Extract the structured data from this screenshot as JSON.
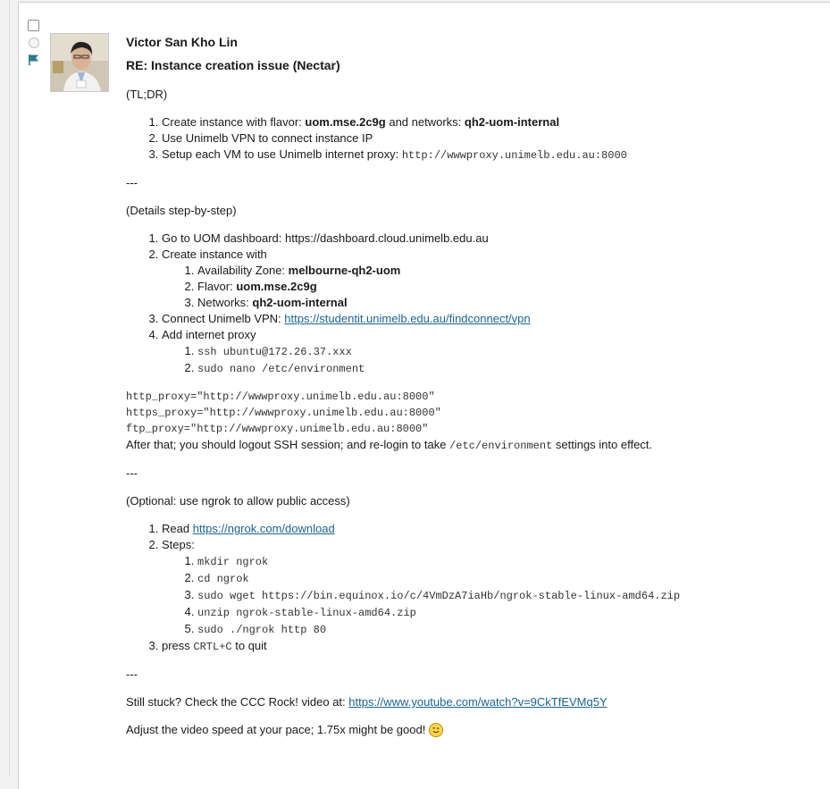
{
  "post": {
    "author": "Victor San Kho Lin",
    "subject": "RE: Instance creation issue (Nectar)",
    "tldr_label": "(TL;DR)",
    "tldr_steps": {
      "s1_text": "Create instance with flavor: ",
      "s1_flavor": "uom.mse.2c9g",
      "s1_mid": " and networks: ",
      "s1_network": "qh2-uom-internal",
      "s2": "Use Unimelb VPN to connect instance IP",
      "s3_text": "Setup each VM to use Unimelb internet proxy: ",
      "s3_proxy": "http://wwwproxy.unimelb.edu.au:8000"
    },
    "separator": "---",
    "details_label": "(Details step-by-step)",
    "details": {
      "d1": "Go to UOM dashboard: https://dashboard.cloud.unimelb.edu.au",
      "d2": "Create instance with",
      "d2a_label": "Availability Zone: ",
      "d2a_value": "melbourne-qh2-uom",
      "d2b_label": "Flavor: ",
      "d2b_value": "uom.mse.2c9g",
      "d2c_label": "Networks: ",
      "d2c_value": "qh2-uom-internal",
      "d3_label": "Connect Unimelb VPN: ",
      "d3_link": "https://studentit.unimelb.edu.au/findconnect/vpn",
      "d4": "Add internet proxy",
      "d4a": "ssh ubuntu@172.26.37.xxx",
      "d4b": "sudo nano /etc/environment"
    },
    "env_lines": [
      "http_proxy=\"http://wwwproxy.unimelb.edu.au:8000\"",
      "https_proxy=\"http://wwwproxy.unimelb.edu.au:8000\"",
      "ftp_proxy=\"http://wwwproxy.unimelb.edu.au:8000\""
    ],
    "after": {
      "before": "After that; you should logout SSH session; and re-login to take ",
      "code": "/etc/environment",
      "after": " settings into effect."
    },
    "optional_label": "(Optional: use ngrok to allow public access)",
    "optional": {
      "o1_label": "Read ",
      "o1_link": "https://ngrok.com/download",
      "o2": "Steps:",
      "o2_steps": [
        "mkdir ngrok",
        "cd ngrok",
        "sudo wget https://bin.equinox.io/c/4VmDzA7iaHb/ngrok-stable-linux-amd64.zip",
        "unzip ngrok-stable-linux-amd64.zip",
        "sudo ./ngrok http 80"
      ],
      "o3_before": "press ",
      "o3_code": "CRTL+C",
      "o3_after": " to quit"
    },
    "stuck_text": "Still stuck? Check the CCC Rock! video at: ",
    "stuck_link": "https://www.youtube.com/watch?v=9CkTfEVMq5Y",
    "closing": "Adjust the video speed at your pace; 1.75x might be good! "
  },
  "colors": {
    "link": "#1a6496",
    "flag": "#2b7a8c"
  }
}
